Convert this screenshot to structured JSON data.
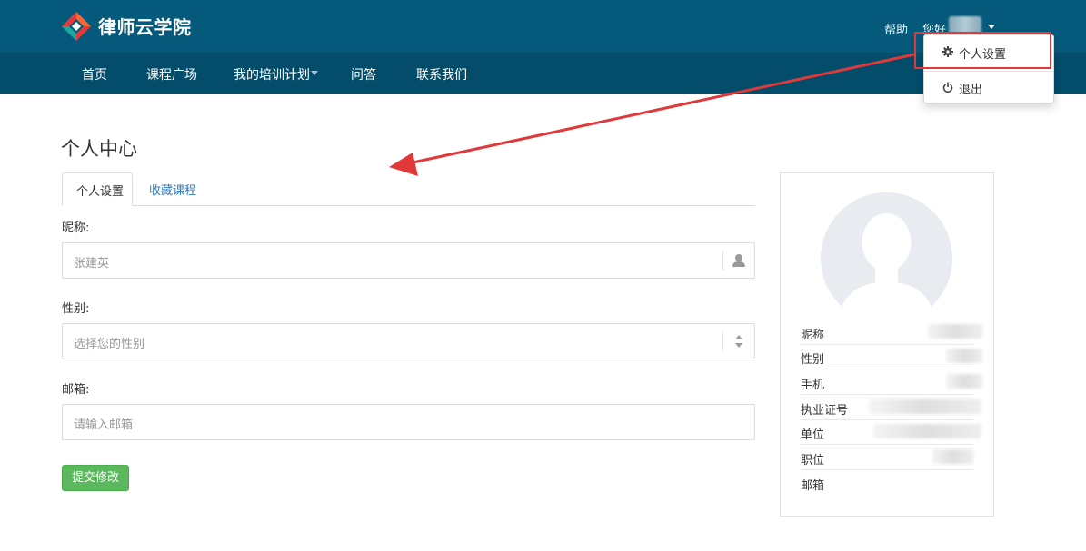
{
  "app": {
    "brand_name": "律师云学院",
    "brand_colors": {
      "header": "#055a7c",
      "nav": "#034d6b",
      "logo_red": "#e5383b",
      "logo_teal": "#1aa7a0"
    }
  },
  "header": {
    "help_label": "帮助",
    "greeting": "您好,",
    "user_menu": {
      "items": [
        {
          "icon": "gear-icon",
          "label": "个人设置"
        },
        {
          "icon": "power-icon",
          "label": "退出"
        }
      ]
    }
  },
  "nav": {
    "items": [
      {
        "label": "首页"
      },
      {
        "label": "课程广场"
      },
      {
        "label": "我的培训计划",
        "has_dropdown": true
      },
      {
        "label": "问答"
      },
      {
        "label": "联系我们"
      }
    ]
  },
  "page": {
    "title": "个人中心",
    "tabs": [
      {
        "label": "个人设置",
        "active": true
      },
      {
        "label": "收藏课程",
        "active": false
      }
    ]
  },
  "form": {
    "nickname": {
      "label": "昵称:",
      "placeholder": "张建英",
      "icon": "user-icon"
    },
    "gender": {
      "label": "性别:",
      "placeholder": "选择您的性别",
      "icon": "sort-arrows-icon"
    },
    "email": {
      "label": "邮箱:",
      "placeholder": "请输入邮箱"
    },
    "submit_label": "提交修改",
    "submit_color": "#5cb85c"
  },
  "profile_card": {
    "fields": [
      {
        "key": "昵称"
      },
      {
        "key": "性别"
      },
      {
        "key": "手机"
      },
      {
        "key": "执业证号"
      },
      {
        "key": "单位"
      },
      {
        "key": "职位"
      },
      {
        "key": "邮箱"
      }
    ]
  },
  "annotation": {
    "color": "#e0393a"
  }
}
